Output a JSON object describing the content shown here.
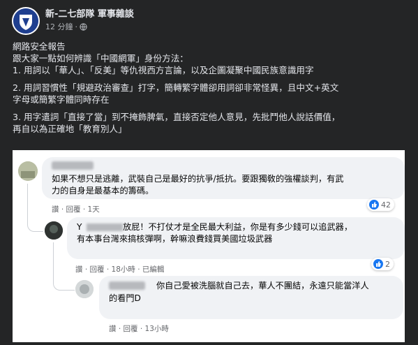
{
  "header": {
    "page_name": "新-二七部隊 軍事雜談",
    "time": "12 分鐘",
    "separator": "·"
  },
  "post": {
    "lines": [
      "網路安全報告",
      "跟大家一點如何辨識「中國網軍」身份方法：",
      "1. 用詞以「華人」、「反美」等仇視西方言論，以及企圖凝聚中國民族意識用字"
    ],
    "point2": [
      "2. 用詞習慣性「規避政治審查」打字，簡轉繁字體卻用詞卻非常怪異，且中文+英文",
      "字母或簡繁字體同時存在"
    ],
    "point3": [
      "3. 用字遣詞「直接了當」到不掩飾脾氣，直接否定他人意見，先批鬥他人說話價值，",
      "再自以為正確地「教育別人」"
    ]
  },
  "comments": [
    {
      "lines": [
        "如果不想只是逃離，武裝自己是最好的抗爭/抵抗。要跟獨敎的強權談判，有武",
        "力的自身是最基本的籌碼。"
      ],
      "actions": "讚 · 回覆 · 1天",
      "reactions": "42"
    },
    {
      "lines": [
        "放屁！不打仗才是全民最大利益，你是有多少錢可以追武器，",
        "有本事台灣來搞核彈啊，幹嘛浪費錢買美國垃圾武器"
      ],
      "name_tail": "Y",
      "actions": "讚 · 回覆 · 18小時 · 已編輯",
      "reactions": "2"
    },
    {
      "lines": [
        "你自己愛被洗腦就自己去，華人不團結，永遠只能當洋人",
        "的看門D"
      ],
      "actions": "讚 · 回覆 · 13小時"
    }
  ],
  "colors": {
    "background": "#242526",
    "screenshot_bg": "#ffffff",
    "bubble": "#f0f2f5",
    "like_blue": "#1877f2"
  }
}
